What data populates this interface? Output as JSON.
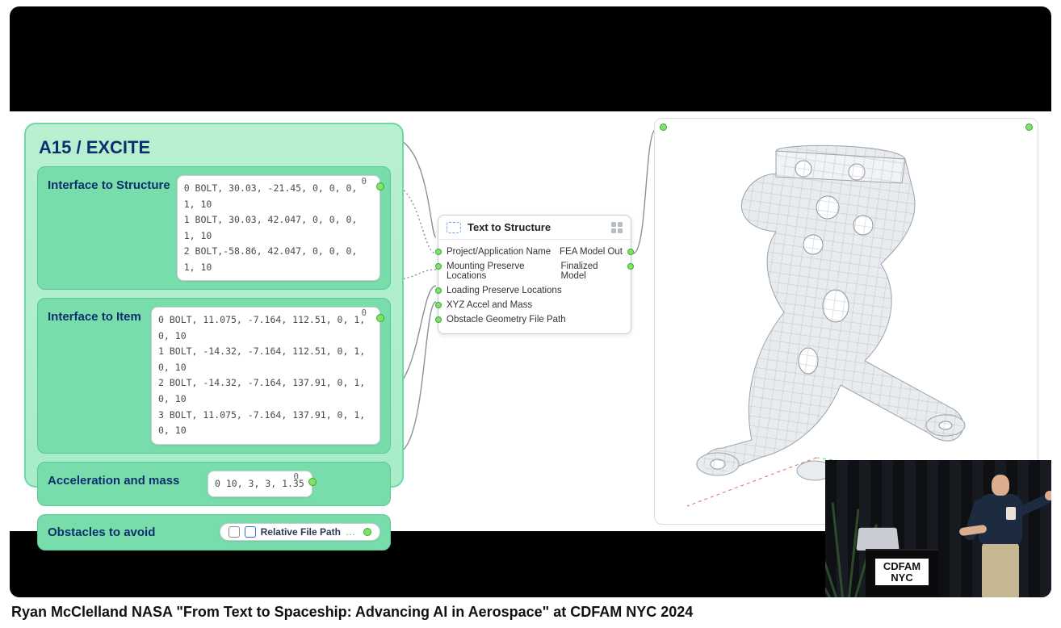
{
  "caption": "Ryan McClelland NASA \"From Text to Spaceship: Advancing AI in Aerospace\" at CDFAM NYC 2024",
  "podium_sign_line1": "CDFAM",
  "podium_sign_line2": "NYC",
  "top_tag": "A15-EXCITE",
  "panel": {
    "title": "A15 / EXCITE",
    "sections": {
      "structure": {
        "label": "Interface to Structure",
        "header_zero": "0",
        "rows": [
          "0  BOLT, 30.03, -21.45, 0, 0, 0, 1, 10",
          "1  BOLT, 30.03, 42.047, 0, 0, 0, 1, 10",
          "2  BOLT,-58.86, 42.047, 0, 0, 0, 1, 10"
        ]
      },
      "item": {
        "label": "Interface to Item",
        "header_zero": "0",
        "rows": [
          "0  BOLT, 11.075, -7.164, 112.51, 0, 1, 0, 10",
          "1  BOLT, -14.32, -7.164, 112.51, 0, 1, 0, 10",
          "2  BOLT, -14.32, -7.164, 137.91, 0, 1, 0, 10",
          "3  BOLT, 11.075, -7.164, 137.91, 0, 1, 0, 10"
        ]
      },
      "accel": {
        "label": "Acceleration and mass",
        "header_zero": "0",
        "rows": [
          "0  10, 3, 3, 1.35"
        ]
      },
      "obstacles": {
        "label": "Obstacles to avoid",
        "file_label": "Relative File Path"
      }
    }
  },
  "node": {
    "title": "Text to Structure",
    "inputs": [
      "Project/Application Name",
      "Mounting Preserve Locations",
      "Loading Preserve Locations",
      "XYZ Accel and Mass",
      "Obstacle Geometry File Path"
    ],
    "outputs": [
      "FEA Model Out",
      "Finalized Model"
    ]
  }
}
